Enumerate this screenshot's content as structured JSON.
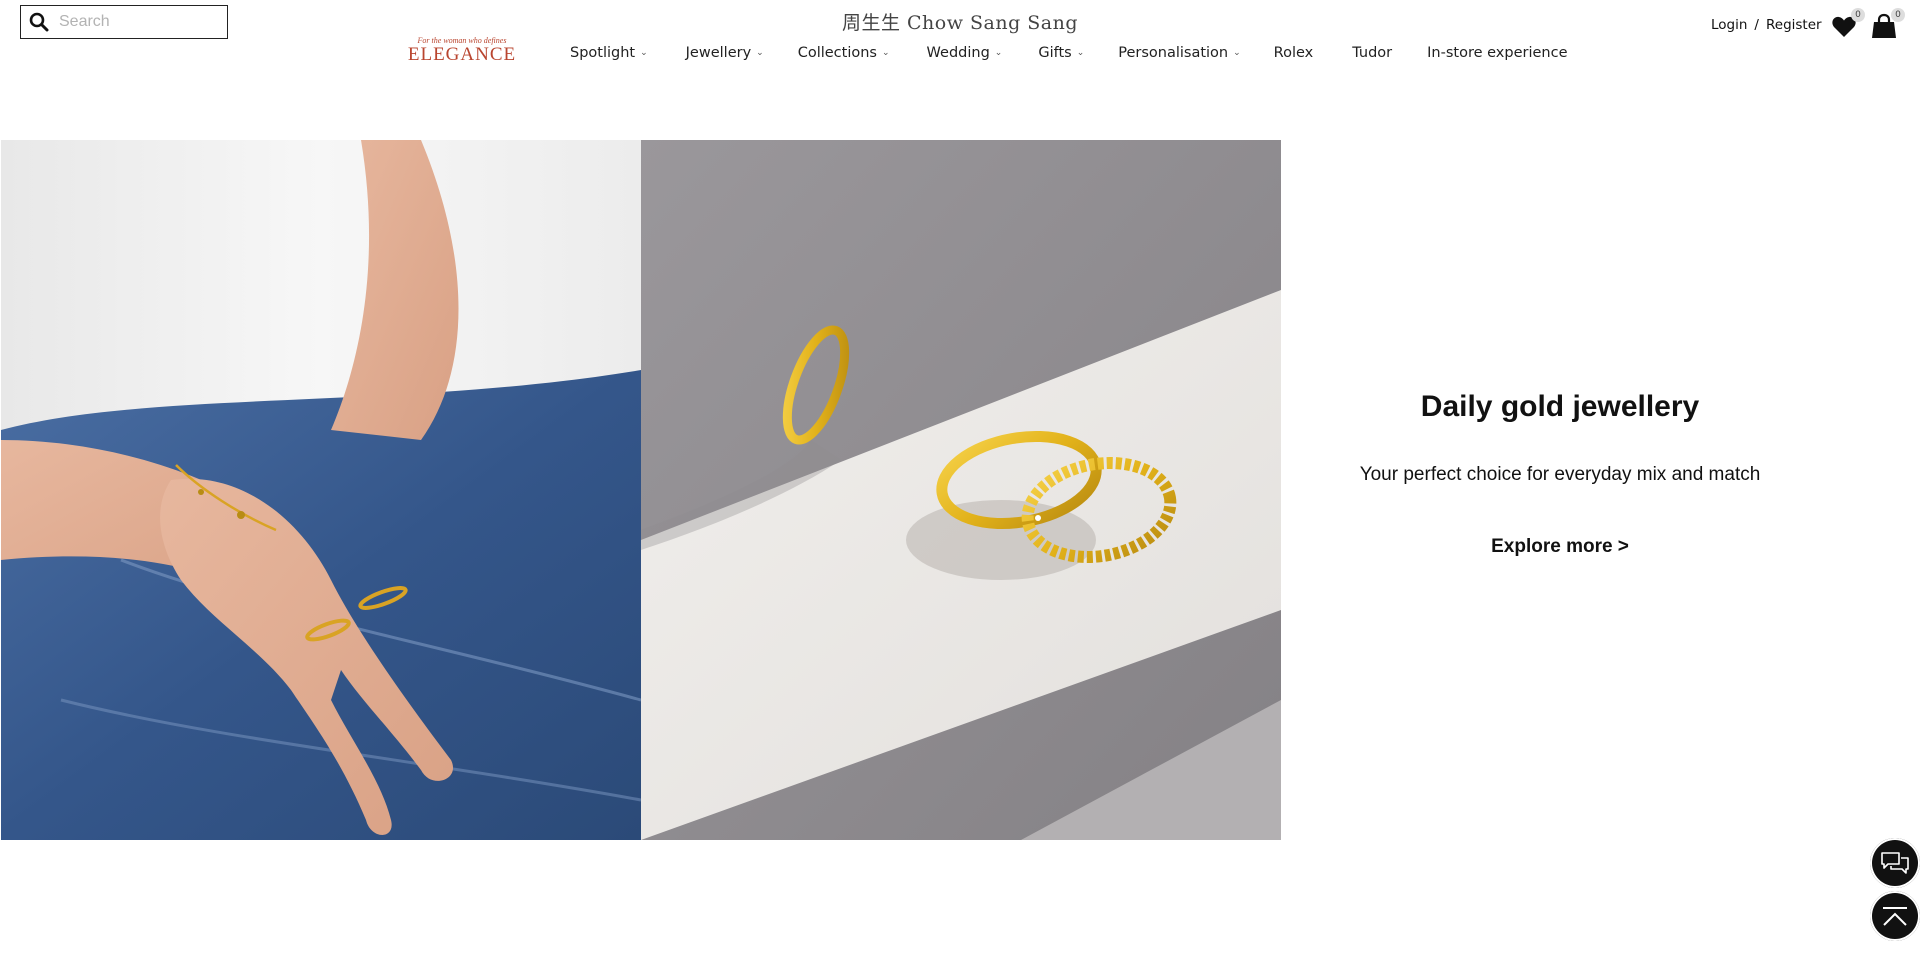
{
  "header": {
    "search_placeholder": "Search",
    "brand": "周生生 Chow Sang Sang",
    "campaign": {
      "tagline": "For the woman who defines",
      "word": "ELEGANCE"
    },
    "nav": [
      {
        "label": "Spotlight",
        "has_dropdown": true
      },
      {
        "label": "Jewellery",
        "has_dropdown": true
      },
      {
        "label": "Collections",
        "has_dropdown": true
      },
      {
        "label": "Wedding",
        "has_dropdown": true
      },
      {
        "label": "Gifts",
        "has_dropdown": true
      },
      {
        "label": "Personalisation",
        "has_dropdown": true
      },
      {
        "label": "Rolex",
        "has_dropdown": false
      },
      {
        "label": "Tudor",
        "has_dropdown": false
      },
      {
        "label": "In-store experience",
        "has_dropdown": false
      }
    ],
    "login_label": "Login",
    "separator": "/",
    "register_label": "Register",
    "wishlist_count": "0",
    "cart_count": "0"
  },
  "hero": {
    "title": "Daily gold jewellery",
    "subtitle": "Your perfect choice for everyday mix and match",
    "cta": "Explore more >"
  },
  "icons": {
    "search": "search-icon",
    "wishlist": "heart-icon",
    "cart": "shopping-bag-icon",
    "chat": "chat-icon",
    "back_to_top": "arrow-up-icon"
  },
  "colors": {
    "accent": "#b9452f",
    "text": "#111111",
    "gold": "#e2b21a",
    "denim": "#3c5f91"
  }
}
